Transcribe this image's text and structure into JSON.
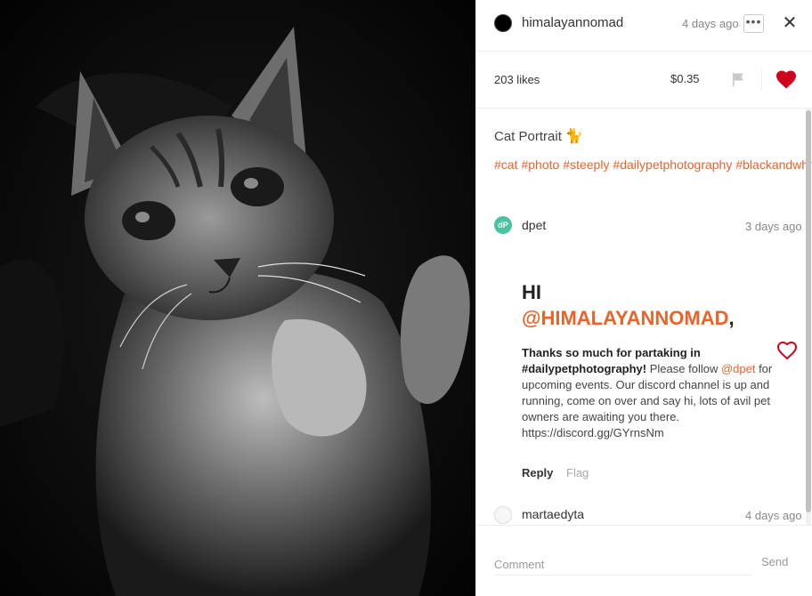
{
  "post": {
    "author": "himalayannomad",
    "time": "4 days ago",
    "more_label": "•••",
    "close_label": "✕",
    "likes": "203 likes",
    "payout": "$0.35",
    "title": "Cat Portrait",
    "title_icon": "🐈",
    "tags": [
      "#cat",
      "#photo",
      "#steeply",
      "#dailypetphotography",
      "#blackandwhitephotography"
    ]
  },
  "comments": [
    {
      "avatar_text": "dP",
      "user": "dpet",
      "time": "3 days ago",
      "greeting": "HI",
      "mention": "@HIMALAYANNOMAD",
      "comma": ",",
      "bold_text": "Thanks so much for partaking in #dailypetphotography!",
      "text_before_link": " Please follow ",
      "link": "@dpet",
      "text_after_link": " for upcoming events. Our discord channel is up and running, come on over and say hi, lots of avil pet owners are awaiting you there. https://discord.gg/GYrnsNm",
      "reply_label": "Reply",
      "flag_label": "Flag"
    },
    {
      "user": "martaedyta",
      "time": "4 days ago"
    }
  ],
  "footer": {
    "comment_placeholder": "Comment",
    "send_label": "Send"
  },
  "colors": {
    "accent": "#e8642b",
    "like_red": "#d0021b"
  },
  "icons": {
    "flag": "flag-icon",
    "heart": "heart-icon",
    "close": "close-icon",
    "more": "more-icon"
  }
}
